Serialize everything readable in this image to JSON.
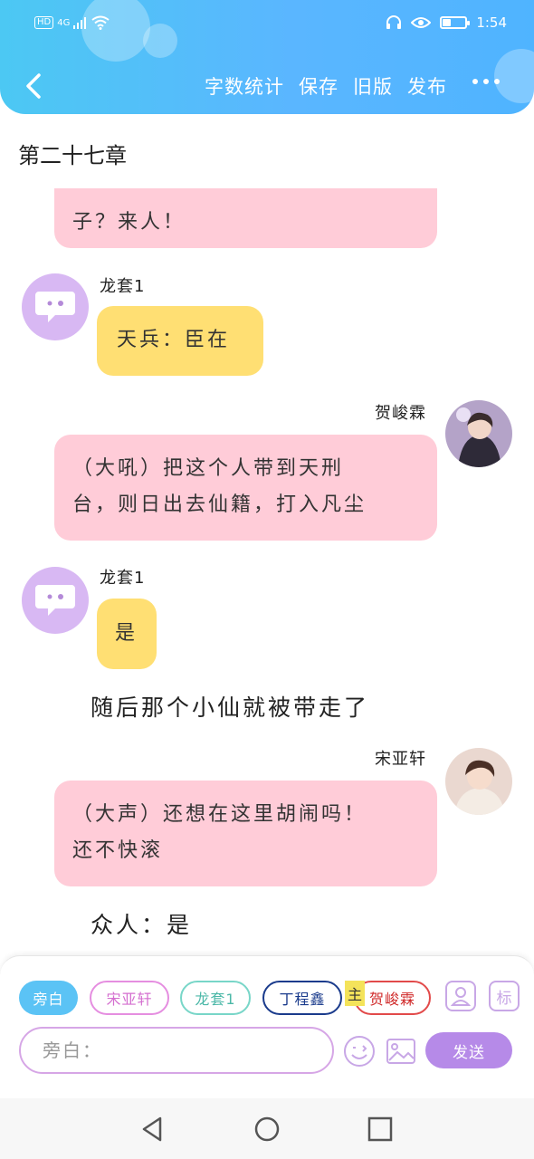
{
  "status_bar": {
    "network": "HD",
    "signal": "4G",
    "time": "1:54",
    "battery_level": 0.35
  },
  "topbar": {
    "actions": [
      "字数统计",
      "保存",
      "旧版",
      "发布"
    ]
  },
  "chapter_title": "第二十七章",
  "messages": [
    {
      "type": "bubble",
      "side": "left",
      "text": "子？来人！",
      "color": "pink"
    },
    {
      "type": "bubble",
      "side": "left",
      "speaker": "龙套1",
      "text": "天兵：臣在",
      "color": "yellow"
    },
    {
      "type": "bubble",
      "side": "right",
      "speaker": "贺峻霖",
      "text": "（大吼）把这个人带到天刑台，则日出去仙籍，打入凡尘",
      "color": "pink"
    },
    {
      "type": "bubble",
      "side": "left",
      "speaker": "龙套1",
      "text": "是",
      "color": "yellow"
    },
    {
      "type": "narration",
      "text": "随后那个小仙就被带走了"
    },
    {
      "type": "bubble",
      "side": "right",
      "speaker": "宋亚轩",
      "text": "（大声）还想在这里胡闹吗！还不快滚",
      "color": "pink"
    },
    {
      "type": "narration",
      "text": "众人：是"
    }
  ],
  "msg_line1": "子？来人！",
  "msg_speaker2": "龙套1",
  "msg_text2": "天兵：臣在",
  "msg_speaker3": "贺峻霖",
  "msg_text3_l1": "（大吼）把这个人带到天刑",
  "msg_text3_l2": "台，则日出去仙籍，打入凡尘",
  "msg_speaker4": "龙套1",
  "msg_text4": "是",
  "narration1": "随后那个小仙就被带走了",
  "msg_speaker5": "宋亚轩",
  "msg_text5_l1": "（大声）还想在这里胡闹吗！",
  "msg_text5_l2": "还不快滚",
  "narration2": "众人：是",
  "roles": [
    "旁白",
    "宋亚轩",
    "龙套1",
    "丁程鑫",
    "贺峻霖"
  ],
  "main_tag": "主",
  "mark_button": "标",
  "input": {
    "placeholder": "旁白：",
    "value": ""
  },
  "send_label": "发送",
  "colors": {
    "header": "#4cc8f3",
    "bubble_pink": "#ffccd8",
    "bubble_yellow": "#ffdf73",
    "send": "#b68ae8",
    "avatar_purple": "#d8b8f3"
  },
  "icons": [
    "back-arrow-icon",
    "more-dots-icon",
    "chat-bubble-avatar-icon",
    "user-card-icon",
    "emoji-icon",
    "image-icon",
    "nav-back-icon",
    "nav-home-icon",
    "nav-recent-icon"
  ]
}
